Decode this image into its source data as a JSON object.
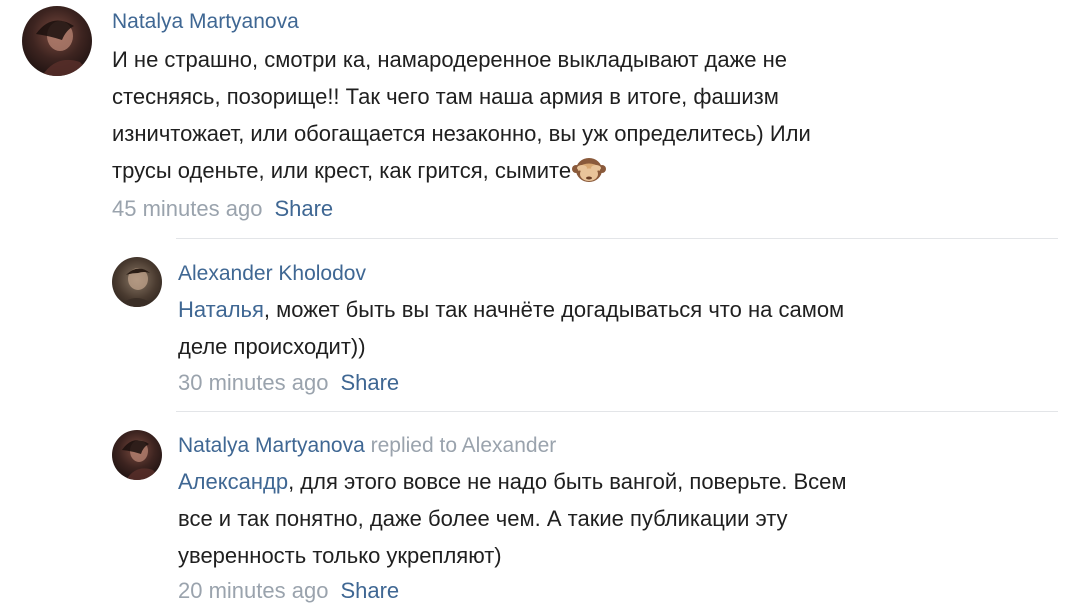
{
  "comments": [
    {
      "author": "Natalya Martyanova",
      "text_lines": [
        "И не страшно, смотри ка, намародеренное выкладывают даже не",
        "стесняясь, позорище!! Так чего там наша армия в итоге, фашизм",
        "изничтожает, или обогащается незаконно, вы уж определитесь) Или",
        "трусы оденьте, или крест, как грится, сымите"
      ],
      "emoji": "see-no-evil-monkey-icon",
      "time": "45 minutes ago",
      "share": "Share"
    },
    {
      "author": "Alexander Kholodov",
      "mention": "Наталья",
      "text_first": ", может быть вы так начнёте догадываться что на самом",
      "text_second": "деле происходит))",
      "time": "30 minutes ago",
      "share": "Share"
    },
    {
      "author": "Natalya Martyanova",
      "replied_to": "replied to Alexander",
      "mention": "Александр",
      "text_first": ", для этого вовсе не надо быть вангой, поверьте. Всем",
      "text_second": "все и так понятно, даже более чем. А такие публикации эту",
      "text_third": "уверенность только укрепляют)",
      "time": "20 minutes ago",
      "share": "Share"
    }
  ],
  "colors": {
    "link": "#3f6793",
    "text": "#1f1f1f",
    "muted": "#9aa3ad",
    "divider": "#e3e5e8"
  }
}
